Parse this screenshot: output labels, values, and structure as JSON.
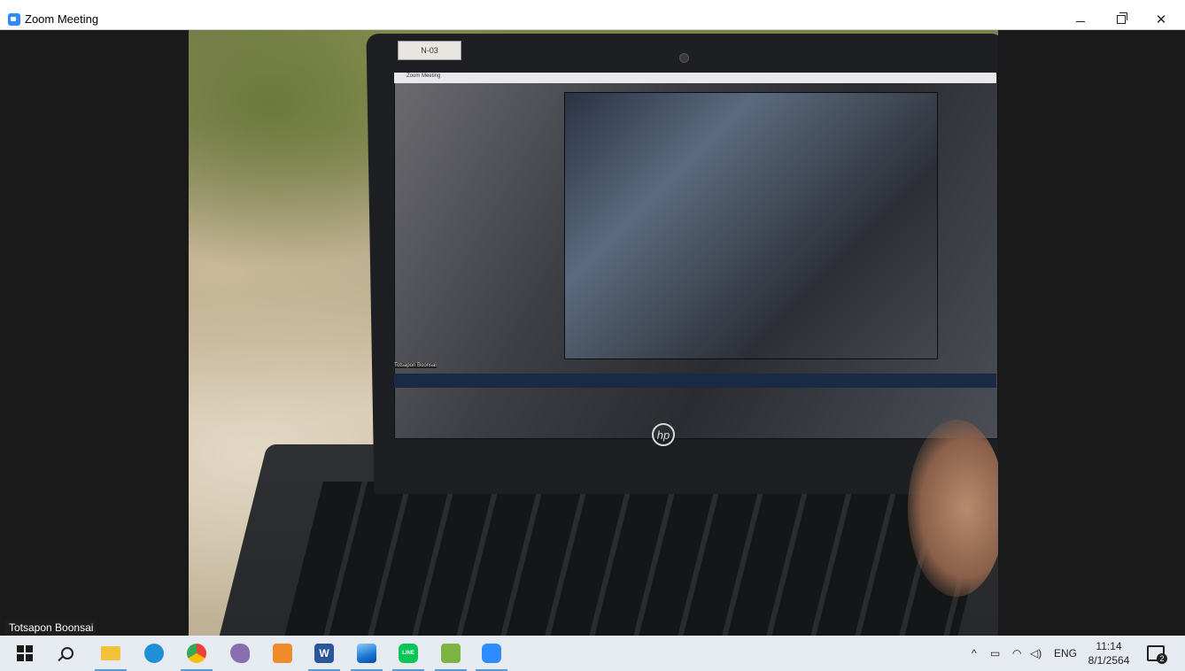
{
  "window": {
    "title": "Zoom Meeting",
    "controls": {
      "minimize": "minimize-icon",
      "restore": "restore-icon",
      "close": "close-icon"
    }
  },
  "video": {
    "participant_name": "Totsapon Boonsai",
    "sticker_label": "N-03",
    "inner_window_title": "Zoom Meeting",
    "inner_participant_name": "Totsapon Boonsai",
    "brand_logo": "hp"
  },
  "taskbar": {
    "apps": [
      {
        "name": "start",
        "icon": "windows-start-icon"
      },
      {
        "name": "search",
        "icon": "search-icon"
      },
      {
        "name": "file-explorer",
        "icon": "folder-icon",
        "color": "#f3c13a"
      },
      {
        "name": "edge",
        "icon": "edge-icon",
        "color": "#1f8fd6"
      },
      {
        "name": "chrome",
        "icon": "chrome-icon",
        "color": "#2f9e44"
      },
      {
        "name": "paint",
        "icon": "paint-icon",
        "color": "#8a6fb0"
      },
      {
        "name": "app-orange",
        "icon": "orange-app-icon",
        "color": "#f08b2b"
      },
      {
        "name": "word",
        "icon": "word-icon",
        "color": "#2b579a",
        "label": "W"
      },
      {
        "name": "photos",
        "icon": "photos-icon",
        "color": "#1976d2"
      },
      {
        "name": "line",
        "icon": "line-icon",
        "color": "#06c755",
        "label": "LINE"
      },
      {
        "name": "android-app",
        "icon": "android-icon",
        "color": "#7cb342"
      },
      {
        "name": "zoom",
        "icon": "zoom-icon",
        "color": "#2d8cff"
      }
    ],
    "tray": {
      "chevron": "^",
      "language": "ENG",
      "time": "11:14",
      "date": "8/1/2564",
      "notification_count": "2"
    }
  }
}
